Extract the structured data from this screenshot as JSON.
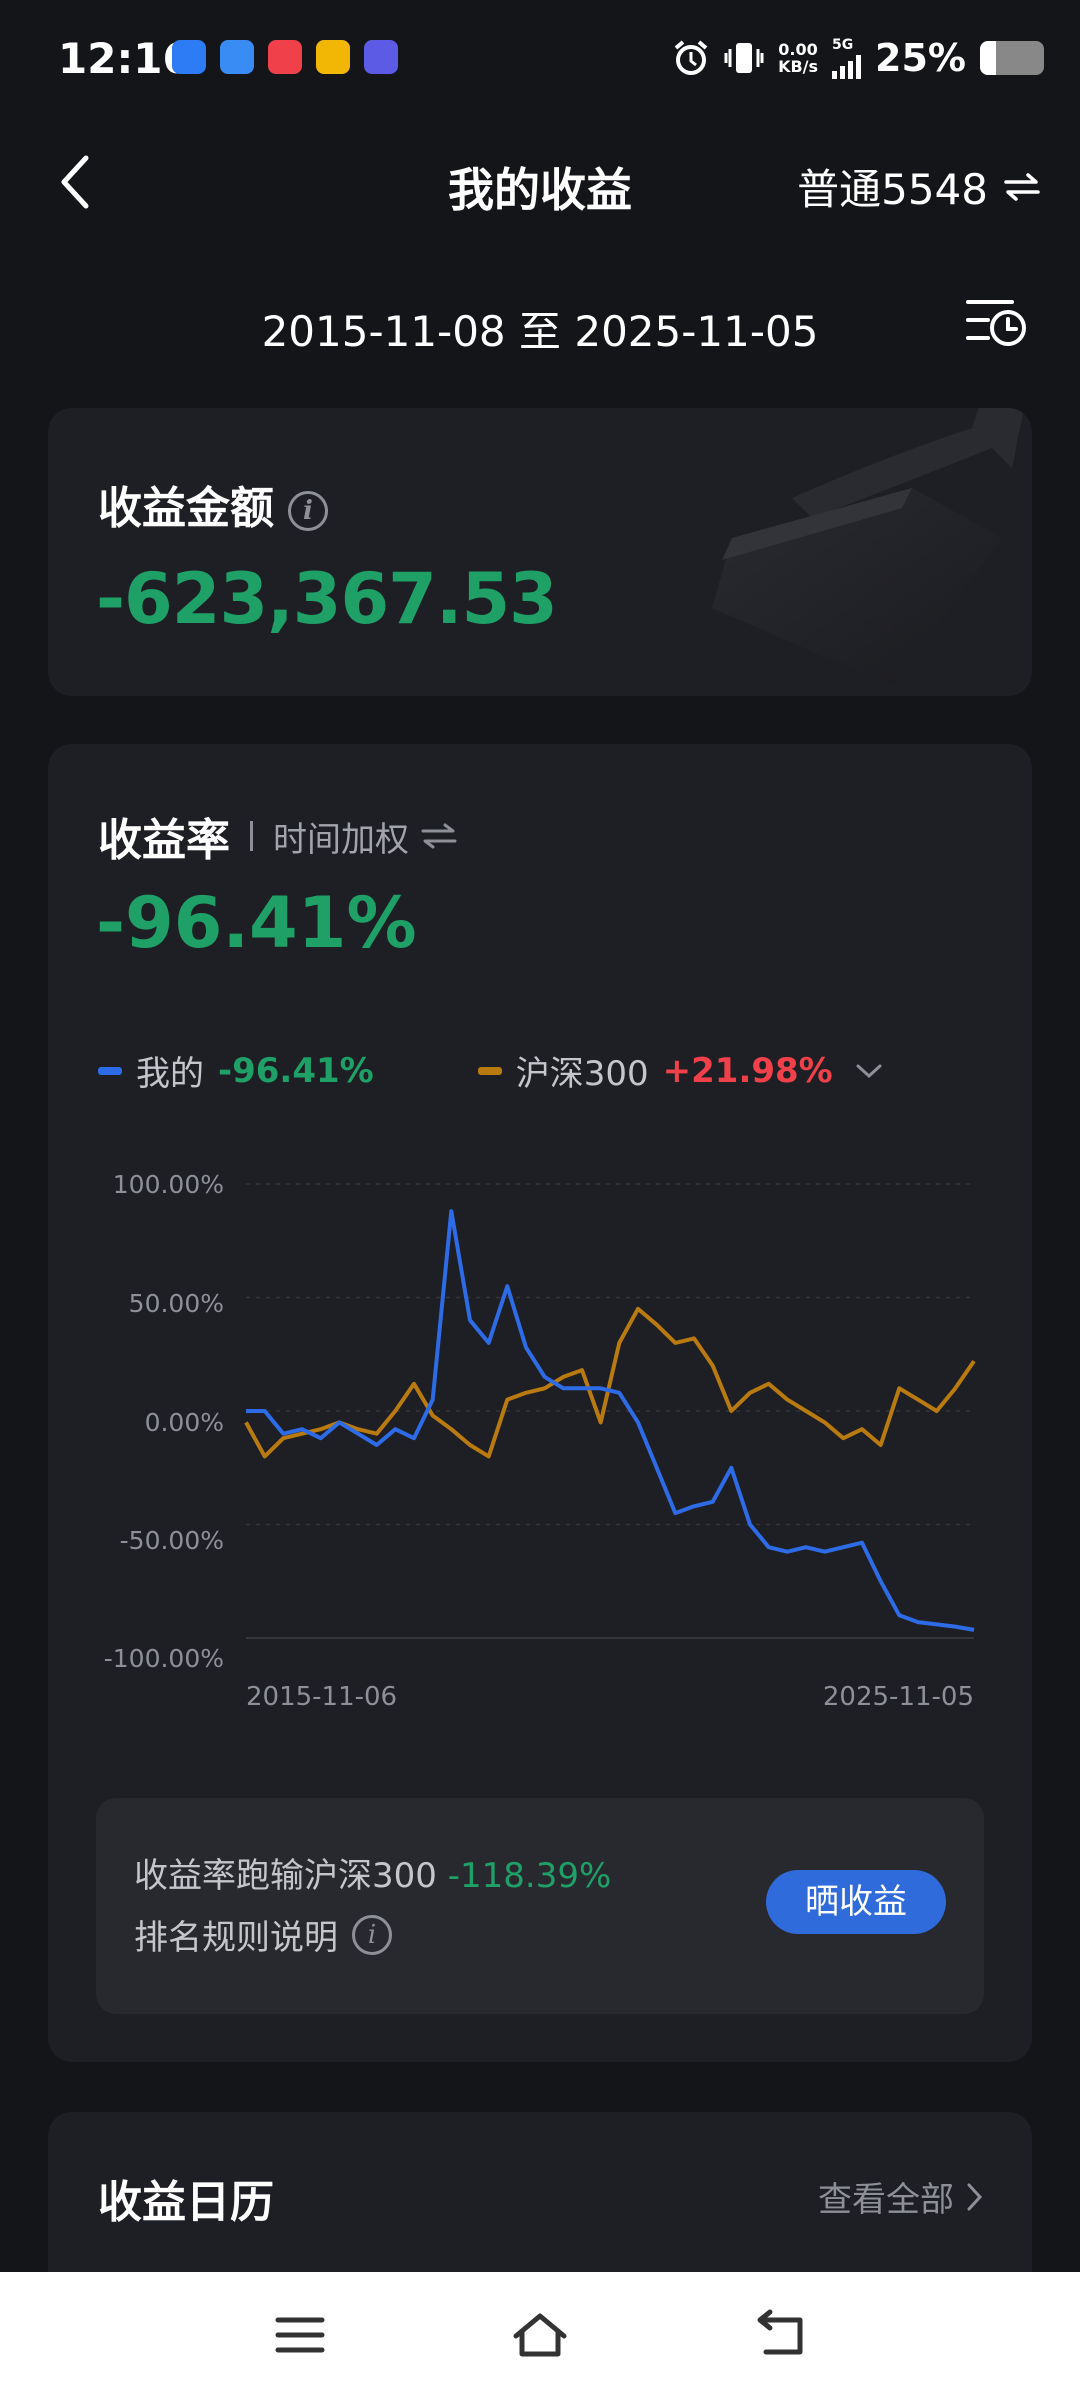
{
  "status_bar": {
    "time": "12:16",
    "net_speed_value": "0.00",
    "net_speed_unit": "KB/s",
    "network": "5G",
    "battery_percent": "25%",
    "app_icon_colors": [
      "#2E7BF6",
      "#3A8CF5",
      "#F0414B",
      "#F2B705",
      "#5B5BE6"
    ]
  },
  "header": {
    "title": "我的收益",
    "account": "普通5548"
  },
  "date_range": {
    "text": "2015-11-08 至 2025-11-05"
  },
  "earnings": {
    "label": "收益金额",
    "amount": "-623,367.53"
  },
  "return_rate": {
    "title": "收益率",
    "mode": "时间加权",
    "value": "-96.41%",
    "legend": [
      {
        "label": "我的",
        "value": "-96.41%",
        "color": "#2E6BE6"
      },
      {
        "label": "沪深300",
        "value": "+21.98%",
        "color": "#B97A10"
      }
    ]
  },
  "chart_data": {
    "type": "line",
    "x_start_label": "2015-11-06",
    "x_end_label": "2025-11-05",
    "y_ticks": [
      "100.00%",
      "50.00%",
      "0.00%",
      "-50.00%",
      "-100.00%"
    ],
    "ylim": [
      -100,
      100
    ],
    "grid": true,
    "series": [
      {
        "name": "我的",
        "color": "#2E6BE6",
        "values": [
          0,
          0,
          -10,
          -8,
          -12,
          -5,
          -10,
          -15,
          -8,
          -12,
          5,
          88,
          40,
          30,
          55,
          28,
          15,
          10,
          10,
          10,
          8,
          -5,
          -25,
          -45,
          -42,
          -40,
          -25,
          -50,
          -60,
          -62,
          -60,
          -62,
          -60,
          -58,
          -75,
          -90,
          -93,
          -94,
          -95,
          -96.41
        ]
      },
      {
        "name": "沪深300",
        "color": "#B97A10",
        "values": [
          -5,
          -20,
          -12,
          -10,
          -8,
          -5,
          -8,
          -10,
          0,
          12,
          -2,
          -8,
          -15,
          -20,
          5,
          8,
          10,
          15,
          18,
          -5,
          30,
          45,
          38,
          30,
          32,
          20,
          0,
          8,
          12,
          5,
          0,
          -5,
          -12,
          -8,
          -15,
          10,
          5,
          0,
          10,
          21.98
        ]
      }
    ]
  },
  "comparison": {
    "text": "收益率跑输沪深300",
    "value": "-118.39%",
    "rules_label": "排名规则说明",
    "share_button": "晒收益"
  },
  "calendar": {
    "title": "收益日历",
    "view_all": "查看全部"
  }
}
